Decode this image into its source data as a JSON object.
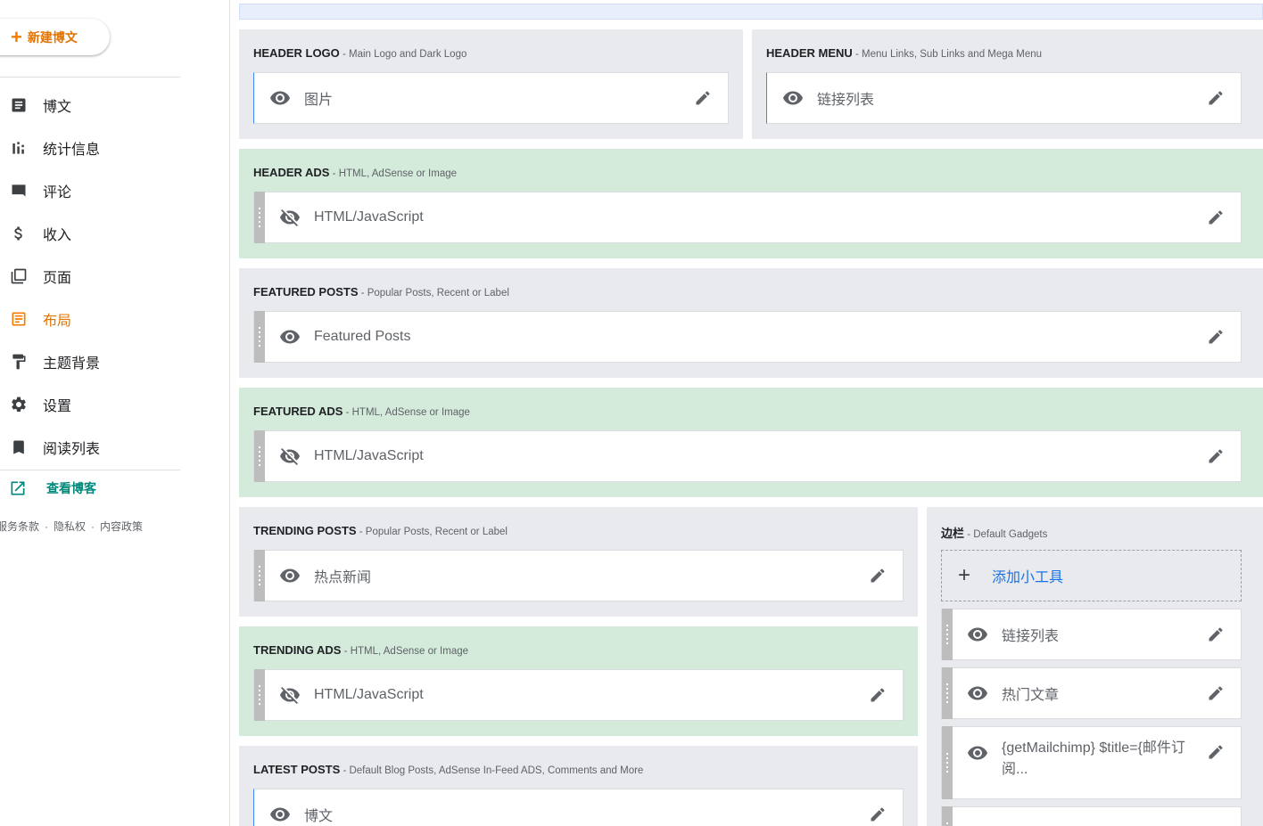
{
  "sidebar": {
    "new_post_label": "新建博文",
    "items": [
      {
        "label": "博文",
        "icon": "posts-icon"
      },
      {
        "label": "统计信息",
        "icon": "stats-icon"
      },
      {
        "label": "评论",
        "icon": "comments-icon"
      },
      {
        "label": "收入",
        "icon": "earnings-icon"
      },
      {
        "label": "页面",
        "icon": "pages-icon"
      },
      {
        "label": "布局",
        "icon": "layout-icon",
        "active": true
      },
      {
        "label": "主题背景",
        "icon": "theme-icon"
      },
      {
        "label": "设置",
        "icon": "settings-icon"
      },
      {
        "label": "阅读列表",
        "icon": "reading-list-icon"
      }
    ],
    "view_blog_label": "查看博客",
    "footer": {
      "terms": "服务条款",
      "privacy": "隐私权",
      "content_policy": "内容政策",
      "separator": "·"
    }
  },
  "sections": {
    "header_logo": {
      "name": "HEADER LOGO",
      "desc": " - Main Logo and Dark Logo",
      "widgets": [
        {
          "name": "图片"
        }
      ]
    },
    "header_menu": {
      "name": "HEADER MENU",
      "desc": " - Menu Links, Sub Links and Mega Menu",
      "widgets": [
        {
          "name": "链接列表"
        }
      ]
    },
    "header_ads": {
      "name": "HEADER ADS",
      "desc": " - HTML, AdSense or Image",
      "widgets": [
        {
          "name": "HTML/JavaScript"
        }
      ]
    },
    "featured_posts": {
      "name": "FEATURED POSTS",
      "desc": " - Popular Posts, Recent or Label",
      "widgets": [
        {
          "name": "Featured Posts"
        }
      ]
    },
    "featured_ads": {
      "name": "FEATURED ADS",
      "desc": " - HTML, AdSense or Image",
      "widgets": [
        {
          "name": "HTML/JavaScript"
        }
      ]
    },
    "trending_posts": {
      "name": "TRENDING POSTS",
      "desc": " - Popular Posts, Recent or Label",
      "widgets": [
        {
          "name": "热点新闻"
        }
      ]
    },
    "trending_ads": {
      "name": "TRENDING ADS",
      "desc": " - HTML, AdSense or Image",
      "widgets": [
        {
          "name": "HTML/JavaScript"
        }
      ]
    },
    "latest_posts": {
      "name": "LATEST POSTS",
      "desc": " - Default Blog Posts, AdSense In-Feed ADS, Comments and More",
      "widgets": [
        {
          "name": "博文"
        }
      ]
    },
    "sidebar_col": {
      "name": "边栏",
      "desc": " - Default Gadgets",
      "add_gadget": "添加小工具",
      "widgets": [
        {
          "name": "链接列表"
        },
        {
          "name": "热门文章"
        },
        {
          "name": "{getMailchimp} $title={邮件订阅..."
        }
      ]
    }
  },
  "colors": {
    "accent": "#e37400",
    "teal": "#00897b",
    "link": "#1a73e8",
    "section_bg": "#e8eaed",
    "ads_bg": "#d4eadb"
  }
}
